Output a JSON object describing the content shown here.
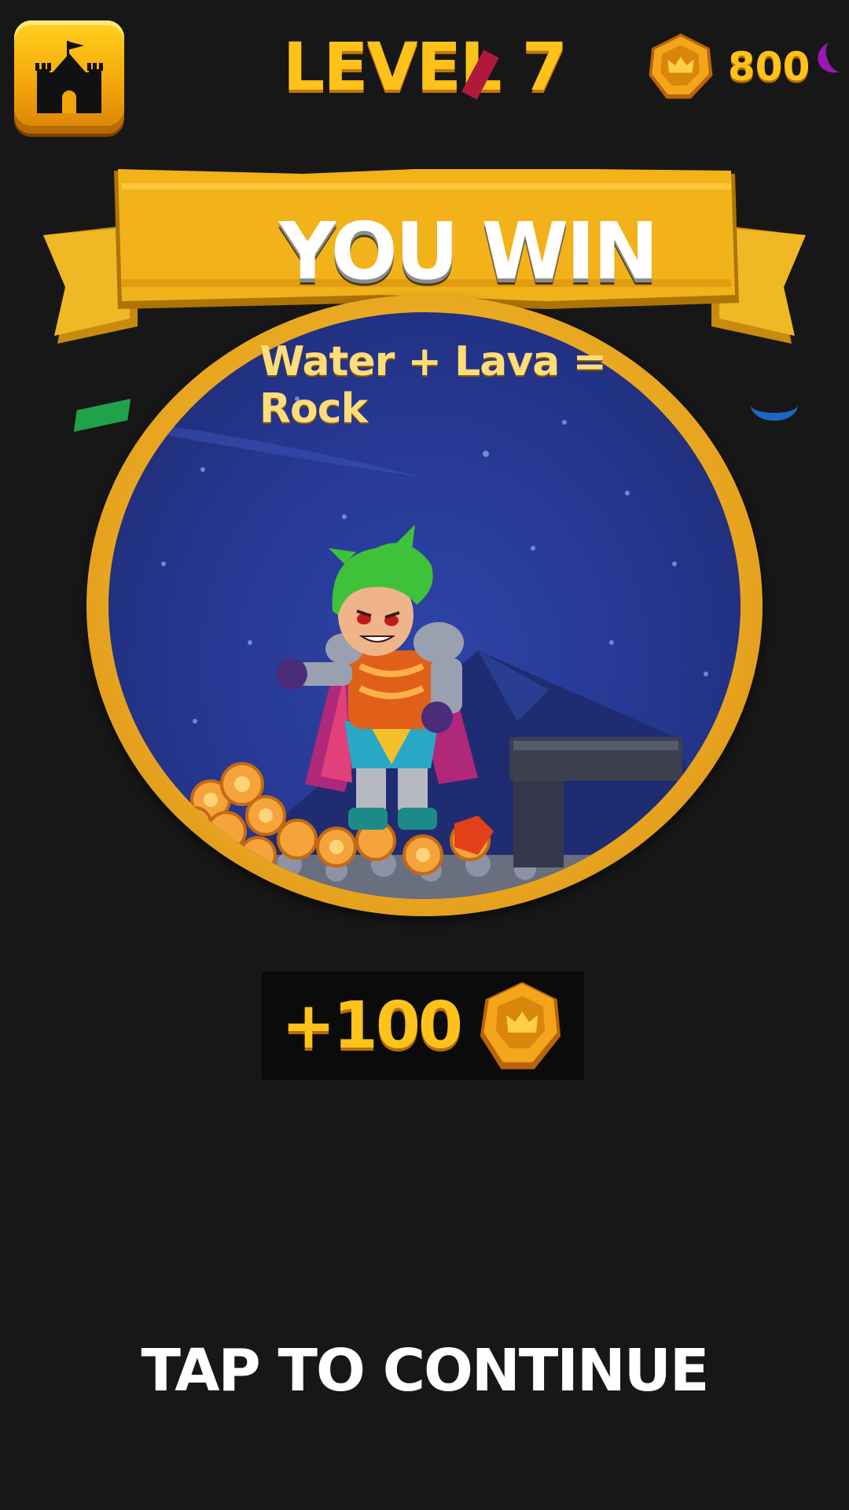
{
  "header": {
    "level_title": "LEVEL 7",
    "coin_count": "800"
  },
  "banner": {
    "title": "YOU WIN"
  },
  "scene": {
    "hint": "Water + Lava = Rock"
  },
  "reward": {
    "amount": "+100"
  },
  "footer": {
    "continue_label": "TAP TO CONTINUE"
  },
  "icons": {
    "home": "castle-icon",
    "coin": "crown-coin-icon"
  },
  "colors": {
    "background": "#171717",
    "gold_text": "#ffc21a",
    "banner": "#f2b21a",
    "night_sky": "#25368f",
    "hero_hair": "#3fc23a"
  }
}
